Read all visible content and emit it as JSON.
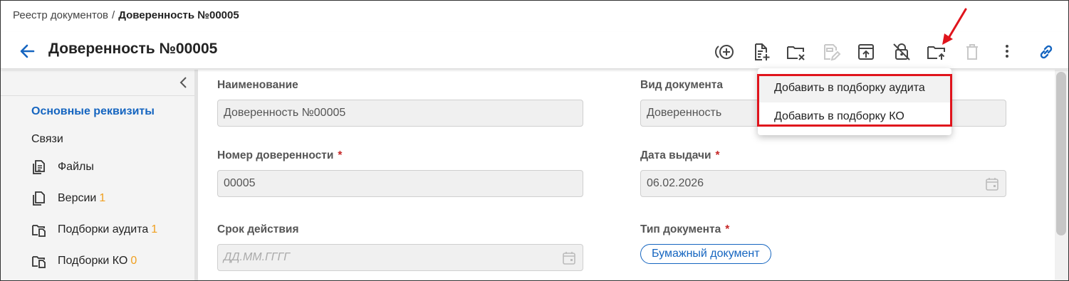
{
  "breadcrumb": {
    "root": "Реестр документов",
    "separator": "/",
    "current": "Доверенность №00005"
  },
  "header": {
    "title": "Доверенность №00005"
  },
  "toolbar": {
    "icons": [
      "add-circle-icon",
      "add-document-icon",
      "remove-from-folder-icon",
      "edit-document-icon",
      "upload-icon",
      "unlock-icon",
      "add-to-folder-icon",
      "delete-icon",
      "more-icon",
      "link-icon"
    ],
    "accent_color": "#1565c0",
    "disabled_color": "#c8c8c8"
  },
  "sidebar": {
    "items": [
      {
        "label": "Основные реквизиты",
        "active": true
      },
      {
        "label": "Связи"
      }
    ],
    "subitems": [
      {
        "label": "Файлы",
        "count": "",
        "icon": "files-icon"
      },
      {
        "label": "Версии",
        "count": "1",
        "icon": "versions-icon"
      },
      {
        "label": "Подборки аудита",
        "count": "1",
        "icon": "folder-doc-icon"
      },
      {
        "label": "Подборки КО",
        "count": "0",
        "icon": "folder-doc-icon"
      }
    ]
  },
  "form": {
    "name_label": "Наименование",
    "name_value": "Доверенность №00005",
    "doc_kind_label": "Вид документа",
    "doc_kind_value": "Доверенность",
    "number_label": "Номер доверенности",
    "number_value": "00005",
    "issue_date_label": "Дата выдачи",
    "issue_date_value": "06.02.2026",
    "validity_label": "Срок действия",
    "validity_placeholder": "ДД.ММ.ГГГГ",
    "doc_type_label": "Тип документа",
    "doc_type_value": "Бумажный документ",
    "required_mark": "*"
  },
  "dropdown": {
    "items": [
      {
        "label": "Добавить в подборку аудита"
      },
      {
        "label": "Добавить в подборку КО"
      }
    ]
  },
  "colors": {
    "highlight": "#e0141c",
    "count": "#f0a020",
    "required": "#c62828"
  }
}
